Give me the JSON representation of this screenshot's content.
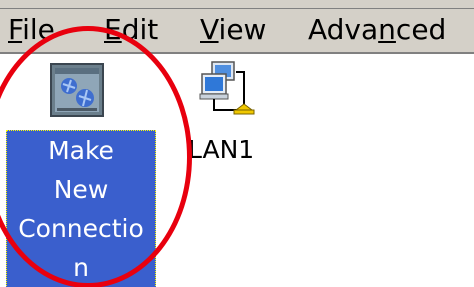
{
  "menubar": {
    "file": {
      "label": "File",
      "mnemonic": "F",
      "rest": "ile"
    },
    "edit": {
      "label": "Edit",
      "mnemonic": "E",
      "rest": "dit"
    },
    "view": {
      "label": "View",
      "mnemonic": "V",
      "rest": "iew"
    },
    "advanced": {
      "label": "Advanced",
      "before": "Adva",
      "mnemonic": "n",
      "after": "ced"
    }
  },
  "items": {
    "make_new_connection": {
      "lines": [
        "Make",
        "New",
        "Connectio",
        "n"
      ],
      "icon": "make-new-connection-icon",
      "selected": true
    },
    "lan1": {
      "label": "LAN1",
      "icon": "network-connection-icon"
    }
  },
  "colors": {
    "selection": "#3a5fcd",
    "annotation": "#e8000e",
    "menubar": "#d4d0c8"
  }
}
